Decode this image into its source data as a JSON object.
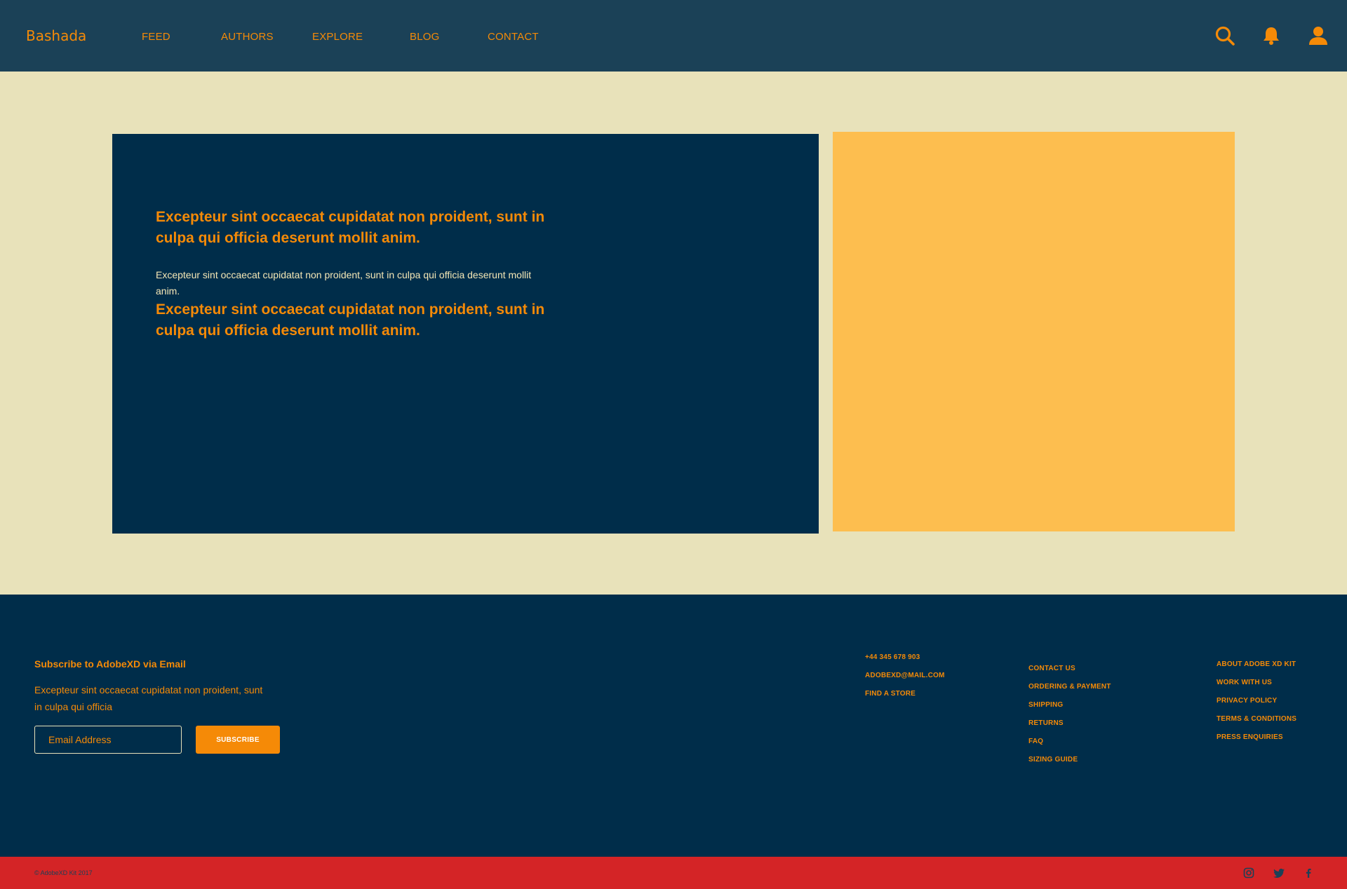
{
  "colors": {
    "header_bg": "#1b4157",
    "page_bg": "#e8e2ba",
    "navy": "#002d4a",
    "accent_orange": "#f58a07",
    "panel_yellow": "#fdbe4f",
    "bottom_bar": "#d42426"
  },
  "header": {
    "brand": "Bashada",
    "nav": [
      "FEED",
      "AUTHORS",
      "EXPLORE",
      "BLOG",
      "CONTACT"
    ],
    "icons": [
      "search-icon",
      "bell-icon",
      "user-icon"
    ]
  },
  "hero": {
    "heading_1": "Excepteur sint occaecat cupidatat non proident, sunt in culpa qui officia deserunt mollit anim.",
    "paragraph": "Excepteur sint occaecat cupidatat non proident, sunt in culpa qui officia deserunt mollit anim.",
    "heading_2": "Excepteur sint occaecat cupidatat non proident, sunt in culpa qui officia deserunt mollit anim."
  },
  "footer": {
    "subscribe_title": "Subscribe to AdobeXD via Email",
    "subscribe_text": "Excepteur sint occaecat cupidatat non proident, sunt in culpa qui officia",
    "email_placeholder": "Email Address",
    "subscribe_button": "SUBSCRIBE",
    "contact": [
      "+44 345 678 903",
      "ADOBEXD@MAIL.COM",
      "FIND A STORE"
    ],
    "help": [
      "CONTACT US",
      "ORDERING & PAYMENT",
      "SHIPPING",
      "RETURNS",
      "FAQ",
      "SIZING GUIDE"
    ],
    "company": [
      "ABOUT ADOBE XD KIT",
      "WORK WITH US",
      "PRIVACY POLICY",
      "TERMS & CONDITIONS",
      "PRESS ENQUIRIES"
    ]
  },
  "bottom": {
    "copyright": "© AdobeXD Kit 2017",
    "social": [
      "instagram-icon",
      "twitter-icon",
      "facebook-icon"
    ]
  }
}
